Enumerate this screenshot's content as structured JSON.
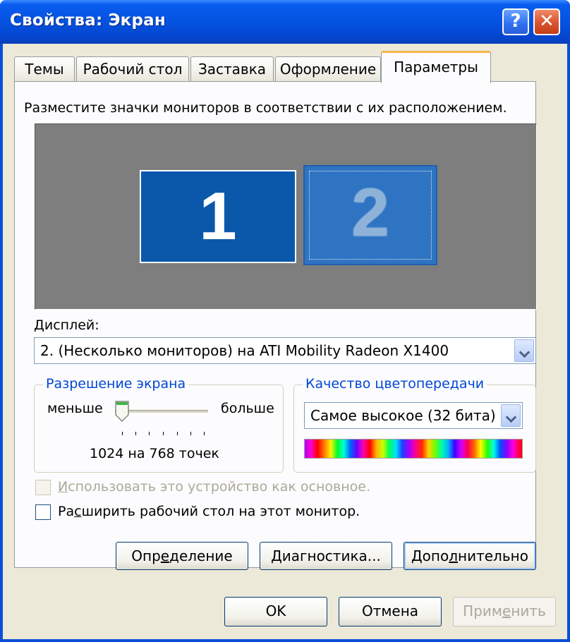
{
  "window": {
    "title": "Свойства: Экран",
    "help_glyph": "?",
    "close_glyph": "✕"
  },
  "tabs": [
    "Темы",
    "Рабочий стол",
    "Заставка",
    "Оформление",
    "Параметры"
  ],
  "active_tab": "Параметры",
  "settings": {
    "instruction": "Разместите значки мониторов в соответствии с их расположением.",
    "monitors": [
      {
        "number": "1",
        "selected": false
      },
      {
        "number": "2",
        "selected": true
      }
    ],
    "display_label": "Дисплей:",
    "display_value": "2. (Несколько мониторов) на ATI Mobility Radeon X1400",
    "resolution": {
      "title": "Разрешение экрана",
      "less": "меньше",
      "more": "больше",
      "value_text": "1024 на 768 точек",
      "slider_position": 0
    },
    "color_quality": {
      "title": "Качество цветопередачи",
      "value": "Самое высокое (32 бита)"
    },
    "primary_checkbox": {
      "pre": "",
      "accel": "И",
      "post": "спользовать это устройство как основное.",
      "checked": false,
      "enabled": false
    },
    "extend_checkbox": {
      "pre": "Ра",
      "accel": "с",
      "post": "ширить рабочий стол на этот монитор.",
      "checked": false,
      "enabled": true
    },
    "buttons": {
      "identify": {
        "pre": "Опр",
        "accel": "е",
        "post": "деление"
      },
      "diagnose": {
        "pre": "",
        "accel": "Д",
        "post": "иагностика..."
      },
      "advanced": {
        "pre": "Допо",
        "accel": "л",
        "post": "нительно"
      }
    }
  },
  "dialog_buttons": {
    "ok": "OK",
    "cancel": "Отмена",
    "apply": {
      "pre": "Прим",
      "accel": "е",
      "post": "нить"
    }
  },
  "colors": {
    "titlebar": "#0552e0",
    "dialog_bg": "#ece9d8",
    "group_title": "#0046d5",
    "monitor_area": "#7e7e7e",
    "monitor_fill": "#0b58ab"
  }
}
